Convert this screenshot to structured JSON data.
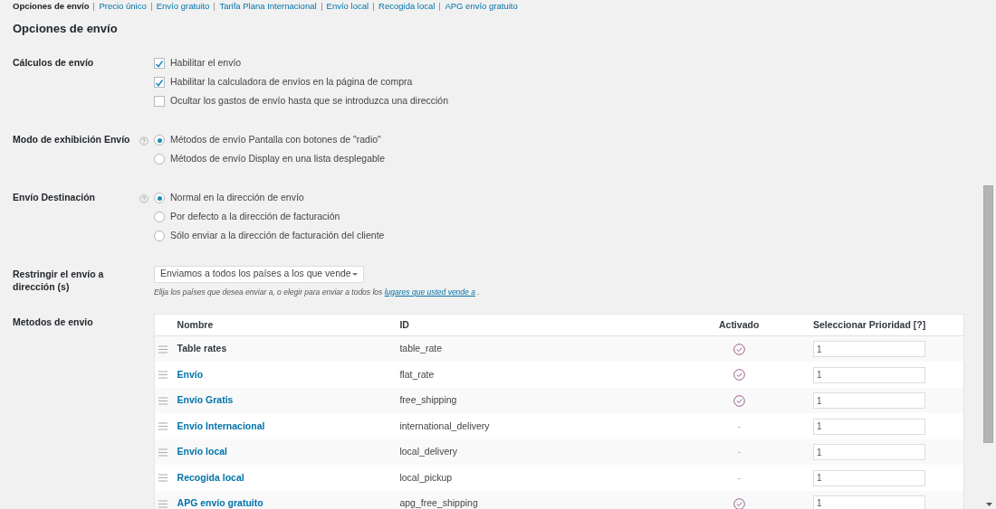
{
  "subnav": [
    {
      "label": "Opciones de envío",
      "selected": true
    },
    {
      "label": "Precio único",
      "selected": false
    },
    {
      "label": "Envío gratuito",
      "selected": false
    },
    {
      "label": "Tarifa Plana Internacional",
      "selected": false
    },
    {
      "label": "Envío local",
      "selected": false
    },
    {
      "label": "Recogida local",
      "selected": false
    },
    {
      "label": "APG envío gratuito",
      "selected": false
    }
  ],
  "heading": "Opciones de envío",
  "settings": [
    {
      "kind": "checkboxes",
      "label": "Cálculos de envío",
      "options": [
        {
          "label": "Habilitar el envío",
          "checked": true
        },
        {
          "label": "Habilitar la calculadora de envíos en la página de compra",
          "checked": true
        },
        {
          "label": "Ocultar los gastos de envío hasta que se introduzca una dirección",
          "checked": false
        }
      ]
    },
    {
      "kind": "radios",
      "label": "Modo de exhibición Envío",
      "options": [
        {
          "label": "Métodos de envío Pantalla con botones de \"radio\"",
          "selected": true
        },
        {
          "label": "Métodos de envío Display en una lista desplegable",
          "selected": false
        }
      ]
    },
    {
      "kind": "radios",
      "label": "Envío Destinación",
      "options": [
        {
          "label": "Normal en la dirección de envío",
          "selected": true
        },
        {
          "label": "Por defecto a la dirección de facturación",
          "selected": false
        },
        {
          "label": "Sólo enviar a la dirección de facturación del cliente",
          "selected": false
        }
      ]
    },
    {
      "kind": "select",
      "label": "Restringir el envío a dirección (s)",
      "value": "Enviamos a todos los países a los que vende",
      "description": "Elija los países que desea enviar a, o elegir para enviar a todos los",
      "link": "lugares que usted vende a",
      "description_end": "."
    },
    {
      "kind": "table",
      "label": "Metodos de envio",
      "columns": [
        "Nombre",
        "ID",
        "Activado",
        "Seleccionar Prioridad [?]"
      ],
      "rows": [
        {
          "name": "Table rates",
          "linked": false,
          "id": "table_rate",
          "enabled": true,
          "priority": "1"
        },
        {
          "name": "Envío",
          "linked": true,
          "id": "flat_rate",
          "enabled": true,
          "priority": "1"
        },
        {
          "name": "Envío Gratis",
          "linked": true,
          "id": "free_shipping",
          "enabled": true,
          "priority": "1"
        },
        {
          "name": "Envío Internacional",
          "linked": true,
          "id": "international_delivery",
          "enabled": false,
          "activated": "-",
          "priority": "1"
        },
        {
          "name": "Envío local",
          "linked": true,
          "id": "local_delivery",
          "enabled": false,
          "activated": "-",
          "priority": "1"
        },
        {
          "name": "Recogida local",
          "linked": true,
          "id": "local_pickup",
          "enabled": false,
          "activated": "-",
          "priority": "1"
        },
        {
          "name": "APG envío gratuito",
          "linked": true,
          "id": "apg_free_shipping",
          "enabled": true,
          "priority": "1"
        }
      ]
    }
  ]
}
